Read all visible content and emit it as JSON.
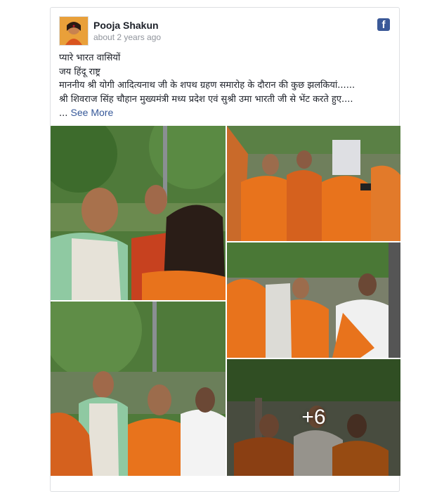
{
  "post": {
    "author": "Pooja Shakun",
    "timestamp": "about 2 years ago",
    "platform_icon": "facebook-icon",
    "lines": [
      "प्यारे भारत वासियों",
      "जय हिंदू राष्ट्र",
      "माननीय श्री योगी आदित्यनाथ जी के शपथ ग्रहण समारोह के दौरान की कुछ झलकियां......",
      "श्री शिवराज सिंह चौहान मुख्यमंत्री मध्य प्रदेश एवं सुश्री उमा भारती जी से भेंट करते हुए....",
      "..."
    ],
    "see_more": "See More"
  },
  "gallery": {
    "more_count": "+6"
  },
  "colors": {
    "brand": "#3b5998",
    "link": "#365899",
    "saffron": "#e8731c"
  }
}
